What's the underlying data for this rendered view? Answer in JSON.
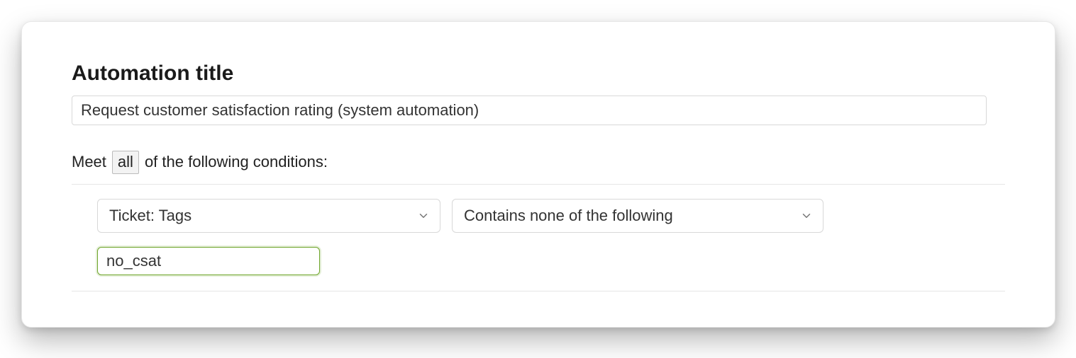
{
  "header": {
    "title": "Automation title"
  },
  "title_field": {
    "value": "Request customer satisfaction rating (system automation)"
  },
  "conditions_intro": {
    "prefix": "Meet",
    "mode": "all",
    "suffix": "of the following conditions:"
  },
  "condition": {
    "field_select": "Ticket: Tags",
    "operator_select": "Contains none of the following",
    "tag_value": "no_csat"
  }
}
